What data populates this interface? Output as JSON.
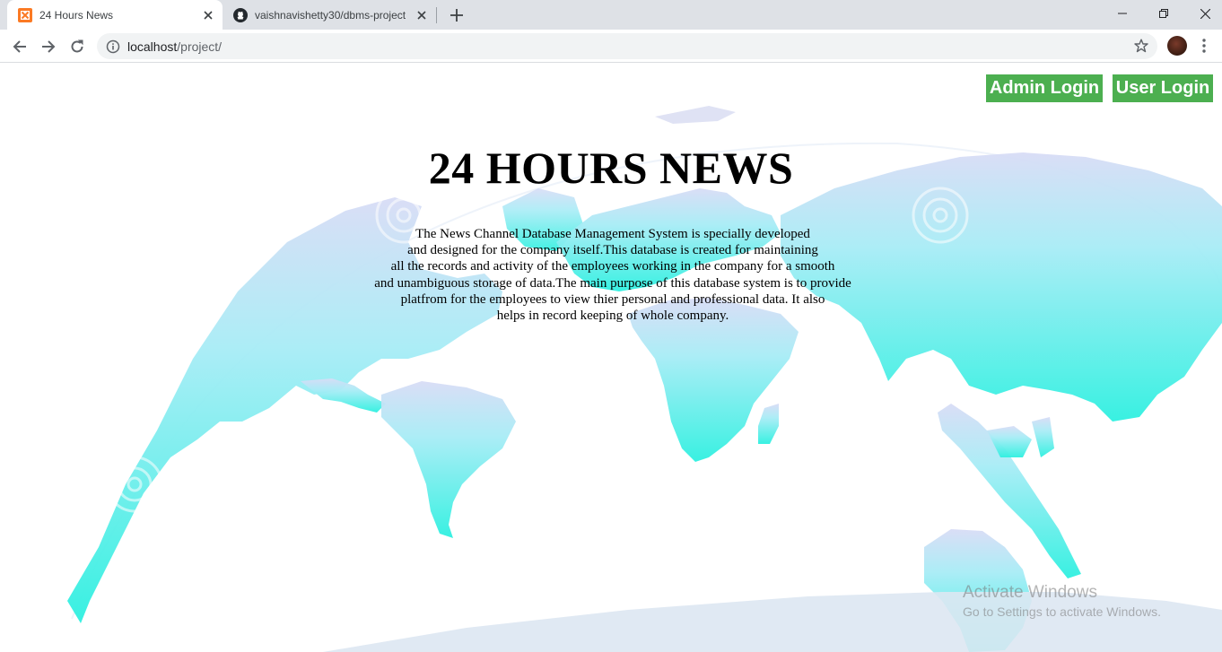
{
  "browser": {
    "tabs": [
      {
        "title": "24 Hours News",
        "active": true
      },
      {
        "title": "vaishnavishetty30/dbms-project",
        "active": false
      }
    ],
    "address": {
      "host": "localhost",
      "path": "/project/"
    }
  },
  "page": {
    "buttons": {
      "admin_login": "Admin Login",
      "user_login": "User Login"
    },
    "headline": "24 HOURS NEWS",
    "description_lines": [
      "The News Channel Database Management System is specially developed",
      "and designed for the company itself.This database is created for maintaining",
      "all the records and activity of the employees working in the company for a smooth",
      "and unambiguous storage of data.The main purpose of this database system is to provide",
      "platfrom for the employees to view thier personal and professional data. It also",
      "helps in record keeping of whole company."
    ],
    "button_color": "#4caf50"
  },
  "os_watermark": {
    "line1": "Activate Windows",
    "line2": "Go to Settings to activate Windows."
  }
}
